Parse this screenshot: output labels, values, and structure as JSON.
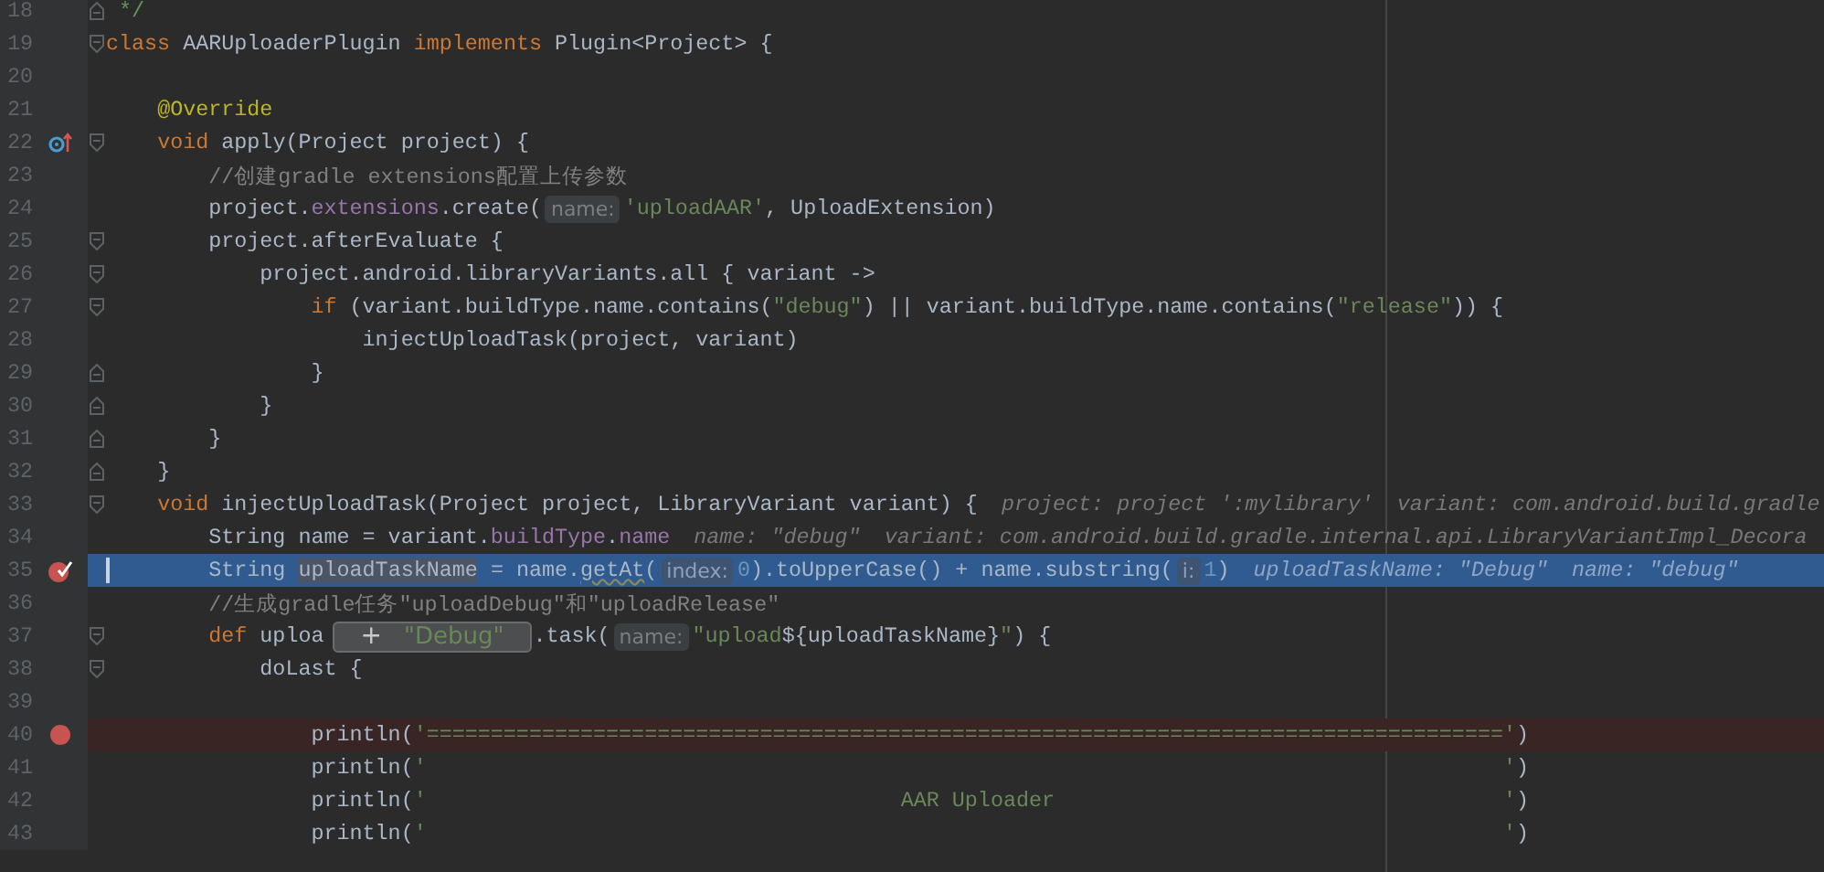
{
  "editor": {
    "lines": [
      {
        "number": "18",
        "fold_marker": {
          "kind": "end"
        },
        "tokens": [
          {
            "kind": "doc",
            "text": " */"
          }
        ]
      },
      {
        "number": "19",
        "fold_marker": {
          "kind": "start"
        },
        "tokens": [
          {
            "kind": "keyword",
            "text": "class"
          },
          {
            "kind": "plain",
            "text": " AARUploaderPlugin "
          },
          {
            "kind": "keyword",
            "text": "implements"
          },
          {
            "kind": "plain",
            "text": " Plugin<Project> {"
          }
        ]
      },
      {
        "number": "20"
      },
      {
        "number": "21",
        "tokens": [
          {
            "kind": "annotation",
            "text": "    @Override"
          }
        ]
      },
      {
        "number": "22",
        "fold_marker": {
          "kind": "start"
        },
        "gutter_icon": {
          "kind": "override"
        },
        "tokens": [
          {
            "kind": "keyword",
            "text": "    void"
          },
          {
            "kind": "plain",
            "text": " apply(Project project) {"
          }
        ]
      },
      {
        "number": "23",
        "tokens": [
          {
            "kind": "comment",
            "text": "        //创建gradle extensions配置上传参数"
          }
        ]
      },
      {
        "number": "24",
        "tokens": [
          {
            "kind": "plain",
            "text": "        project."
          },
          {
            "kind": "field",
            "text": "extensions"
          },
          {
            "kind": "plain",
            "text": ".create("
          },
          {
            "kind": "hint",
            "text": "name:"
          },
          {
            "kind": "string",
            "text": "'uploadAAR'"
          },
          {
            "kind": "plain",
            "text": ", UploadExtension)"
          }
        ]
      },
      {
        "number": "25",
        "fold_marker": {
          "kind": "start"
        },
        "tokens": [
          {
            "kind": "plain",
            "text": "        project.afterEvaluate {"
          }
        ]
      },
      {
        "number": "26",
        "fold_marker": {
          "kind": "start"
        },
        "tokens": [
          {
            "kind": "plain",
            "text": "            project.android.libraryVariants.all { variant ->"
          }
        ]
      },
      {
        "number": "27",
        "fold_marker": {
          "kind": "start"
        },
        "tokens": [
          {
            "kind": "keyword",
            "text": "                if"
          },
          {
            "kind": "plain",
            "text": " (variant.buildType.name.contains("
          },
          {
            "kind": "string",
            "text": "\"debug\""
          },
          {
            "kind": "plain",
            "text": ") || variant.buildType.name.contains("
          },
          {
            "kind": "string",
            "text": "\"release\""
          },
          {
            "kind": "plain",
            "text": ")) {"
          }
        ]
      },
      {
        "number": "28",
        "tokens": [
          {
            "kind": "plain",
            "text": "                    injectUploadTask(project, variant)"
          }
        ]
      },
      {
        "number": "29",
        "fold_marker": {
          "kind": "end"
        },
        "tokens": [
          {
            "kind": "plain",
            "text": "                }"
          }
        ]
      },
      {
        "number": "30",
        "fold_marker": {
          "kind": "end"
        },
        "tokens": [
          {
            "kind": "plain",
            "text": "            }"
          }
        ]
      },
      {
        "number": "31",
        "fold_marker": {
          "kind": "end"
        },
        "tokens": [
          {
            "kind": "plain",
            "text": "        }"
          }
        ]
      },
      {
        "number": "32",
        "fold_marker": {
          "kind": "end"
        },
        "tokens": [
          {
            "kind": "plain",
            "text": "    }"
          }
        ]
      },
      {
        "number": "33",
        "fold_marker": {
          "kind": "start"
        },
        "tokens": [
          {
            "kind": "keyword",
            "text": "    void"
          },
          {
            "kind": "plain",
            "text": " injectUploadTask(Project project, LibraryVariant variant) {"
          },
          {
            "kind": "value",
            "text": "project: project ':mylibrary'"
          },
          {
            "kind": "value",
            "text": "variant: com.android.build.gradle"
          }
        ]
      },
      {
        "number": "34",
        "tokens": [
          {
            "kind": "plain",
            "text": "        String name = variant."
          },
          {
            "kind": "field",
            "text": "buildType"
          },
          {
            "kind": "plain",
            "text": "."
          },
          {
            "kind": "field",
            "text": "name"
          },
          {
            "kind": "value",
            "text": "name: \"debug\""
          },
          {
            "kind": "value",
            "text": "variant: com.android.build.gradle.internal.api.LibraryVariantImpl_Decora"
          }
        ]
      },
      {
        "number": "35",
        "kind": "current",
        "gutter_icon": {
          "kind": "breakpoint-verified"
        },
        "tokens": [
          {
            "kind": "plain",
            "text": "        String "
          },
          {
            "kind": "usage",
            "text": "uploadTaskName"
          },
          {
            "kind": "plain",
            "text": " = name."
          },
          {
            "kind": "warning",
            "text": "getAt"
          },
          {
            "kind": "plain",
            "text": "("
          },
          {
            "kind": "hint",
            "text": "index:"
          },
          {
            "kind": "number",
            "text": "0"
          },
          {
            "kind": "plain",
            "text": ").toUpperCase() + name.substring("
          },
          {
            "kind": "hint",
            "text": "i:"
          },
          {
            "kind": "number",
            "text": "1"
          },
          {
            "kind": "plain",
            "text": ")"
          },
          {
            "kind": "value",
            "text": "uploadTaskName: \"Debug\""
          },
          {
            "kind": "value",
            "text": "name: \"debug\""
          }
        ]
      },
      {
        "number": "36",
        "tokens": [
          {
            "kind": "comment",
            "text": "        //生成gradle任务\"uploadDebug\"和\"uploadRelease\""
          }
        ]
      },
      {
        "number": "37",
        "fold_marker": {
          "kind": "start"
        },
        "tokens": [
          {
            "kind": "keyword",
            "text": "        def"
          },
          {
            "kind": "plain",
            "text": " uploa"
          },
          {
            "kind": "popup",
            "expander": "+",
            "text": "\"Debug\""
          },
          {
            "kind": "plain",
            "text": ".task("
          },
          {
            "kind": "hint",
            "text": "name:"
          },
          {
            "kind": "string",
            "text": "\"upload"
          },
          {
            "kind": "plain",
            "text": "${uploadTaskName}"
          },
          {
            "kind": "string",
            "text": "\""
          },
          {
            "kind": "plain",
            "text": ") {"
          }
        ]
      },
      {
        "number": "38",
        "fold_marker": {
          "kind": "start"
        },
        "tokens": [
          {
            "kind": "plain",
            "text": "            doLast {"
          }
        ]
      },
      {
        "number": "39"
      },
      {
        "number": "40",
        "kind": "breakpoint",
        "gutter_icon": {
          "kind": "breakpoint"
        },
        "tokens": [
          {
            "kind": "plain",
            "text": "                println("
          },
          {
            "kind": "string",
            "text": "'===================================================================================='"
          },
          {
            "kind": "plain",
            "text": ")"
          }
        ]
      },
      {
        "number": "41",
        "tokens": [
          {
            "kind": "plain",
            "text": "                println("
          },
          {
            "kind": "string",
            "text": "'                                                                                    '"
          },
          {
            "kind": "plain",
            "text": ")"
          }
        ]
      },
      {
        "number": "42",
        "tokens": [
          {
            "kind": "plain",
            "text": "                println("
          },
          {
            "kind": "string",
            "text": "'                                     AAR Uploader                                   '"
          },
          {
            "kind": "plain",
            "text": ")"
          }
        ]
      },
      {
        "number": "43",
        "tokens": [
          {
            "kind": "plain",
            "text": "                println("
          },
          {
            "kind": "string",
            "text": "'                                                                                    '"
          },
          {
            "kind": "plain",
            "text": ")"
          }
        ]
      }
    ]
  }
}
